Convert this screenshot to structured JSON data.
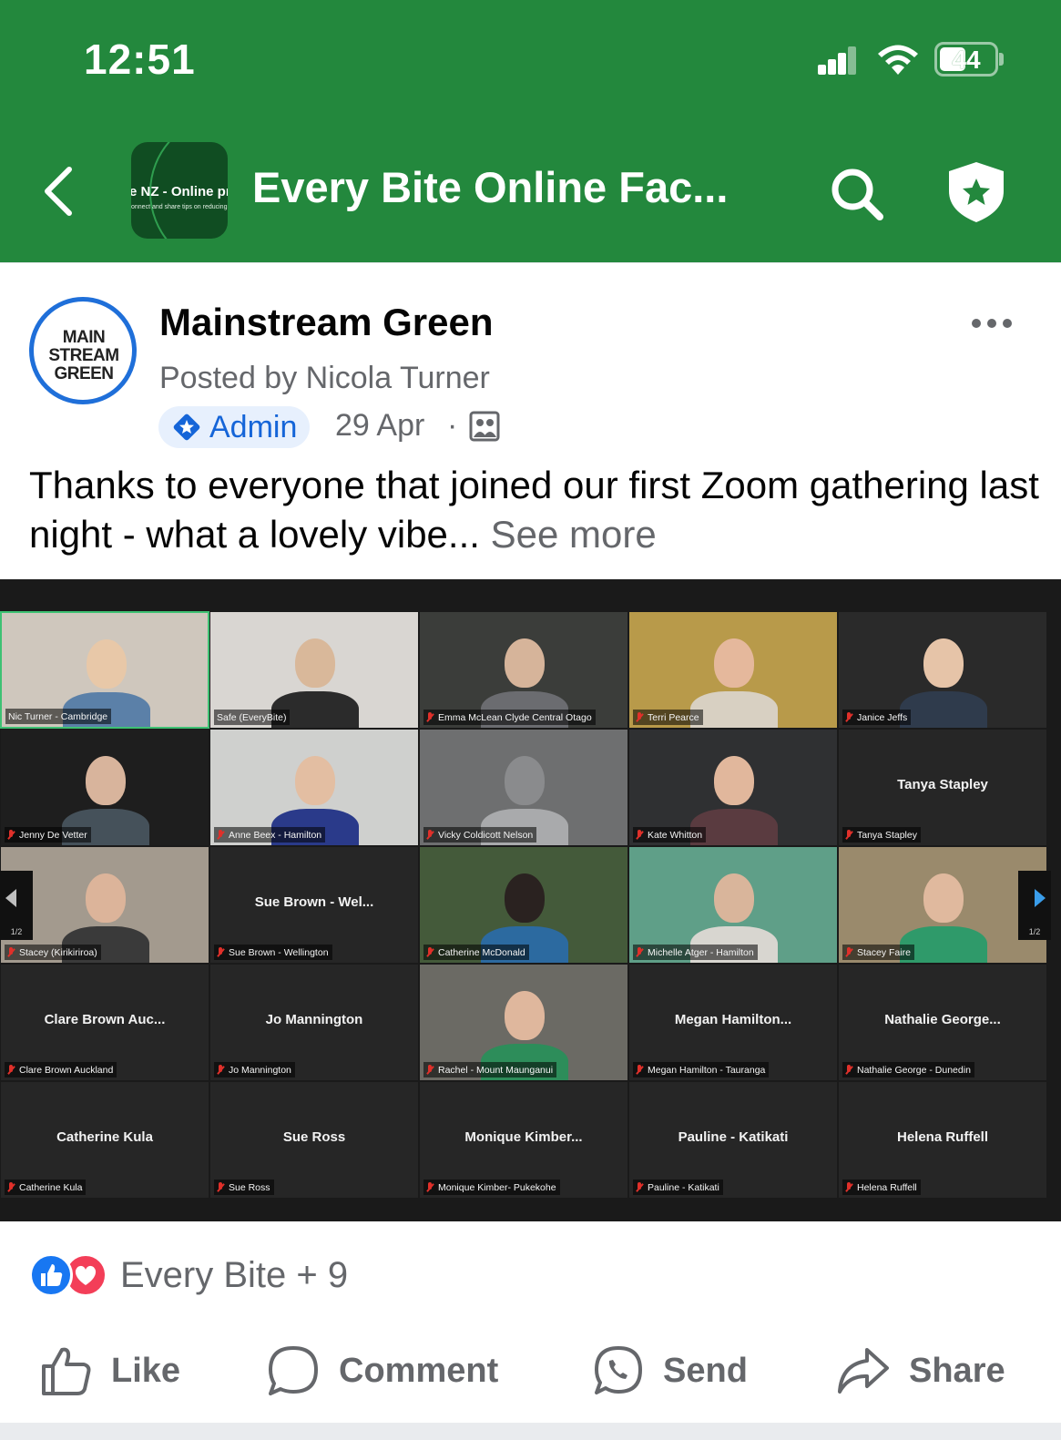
{
  "status_bar": {
    "time": "12:51",
    "battery": "44"
  },
  "header": {
    "group_title": "Every Bite Online Fac...",
    "thumb_line1": "e NZ - Online pr",
    "thumb_line2": "onnect and share tips on reducing",
    "icons": [
      "back-arrow-icon",
      "search-icon",
      "shield-star-icon"
    ]
  },
  "post": {
    "avatar_text": [
      "MAIN",
      "STREAM",
      "GREEN"
    ],
    "page_name": "Mainstream Green",
    "posted_by": "Posted by Nicola Turner",
    "badge": "Admin",
    "date": "29 Apr",
    "separator": "·",
    "text": "Thanks to everyone that joined our first Zoom gathering last night  -  what a lovely vibe...",
    "see_more": "See more"
  },
  "zoom": {
    "page_indicator": "1/2",
    "tiles": [
      {
        "label": "Nic Turner - Cambridge",
        "name": "",
        "video": true,
        "muted": false
      },
      {
        "label": "Safe (EveryBite)",
        "name": "",
        "video": true,
        "muted": false
      },
      {
        "label": "Emma McLean Clyde Central Otago",
        "name": "",
        "video": true,
        "muted": true
      },
      {
        "label": "Terri Pearce",
        "name": "",
        "video": true,
        "muted": true
      },
      {
        "label": "Janice Jeffs",
        "name": "",
        "video": true,
        "muted": true
      },
      {
        "label": "Jenny De Vetter",
        "name": "",
        "video": true,
        "muted": true
      },
      {
        "label": "Anne Beex - Hamilton",
        "name": "",
        "video": true,
        "muted": true
      },
      {
        "label": "Vicky Coldicott Nelson",
        "name": "",
        "video": true,
        "muted": true
      },
      {
        "label": "Kate Whitton",
        "name": "",
        "video": true,
        "muted": true
      },
      {
        "label": "Tanya Stapley",
        "name": "Tanya Stapley",
        "video": false,
        "muted": true
      },
      {
        "label": "Stacey (Kirikiriroa)",
        "name": "",
        "video": true,
        "muted": true
      },
      {
        "label": "Sue Brown - Wellington",
        "name": "Sue Brown - Wel...",
        "video": false,
        "muted": true
      },
      {
        "label": "Catherine McDonald",
        "name": "",
        "video": true,
        "muted": true
      },
      {
        "label": "Michelle Atger - Hamilton",
        "name": "",
        "video": true,
        "muted": true
      },
      {
        "label": "Stacey Faire",
        "name": "",
        "video": true,
        "muted": true
      },
      {
        "label": "Clare Brown Auckland",
        "name": "Clare Brown Auc...",
        "video": false,
        "muted": true
      },
      {
        "label": "Jo Mannington",
        "name": "Jo Mannington",
        "video": false,
        "muted": true
      },
      {
        "label": "Rachel - Mount Maunganui",
        "name": "",
        "video": true,
        "muted": true
      },
      {
        "label": "Megan Hamilton - Tauranga",
        "name": "Megan Hamilton...",
        "video": false,
        "muted": true
      },
      {
        "label": "Nathalie George - Dunedin",
        "name": "Nathalie George...",
        "video": false,
        "muted": true
      },
      {
        "label": "Catherine Kula",
        "name": "Catherine Kula",
        "video": false,
        "muted": true
      },
      {
        "label": "Sue Ross",
        "name": "Sue Ross",
        "video": false,
        "muted": true
      },
      {
        "label": "Monique Kimber- Pukekohe",
        "name": "Monique Kimber...",
        "video": false,
        "muted": true
      },
      {
        "label": "Pauline - Katikati",
        "name": "Pauline - Katikati",
        "video": false,
        "muted": true
      },
      {
        "label": "Helena Ruffell",
        "name": "Helena Ruffell",
        "video": false,
        "muted": true
      }
    ]
  },
  "reactions": {
    "summary": "Every Bite + 9",
    "types": [
      "like-icon",
      "love-icon"
    ]
  },
  "actions": {
    "like": "Like",
    "comment": "Comment",
    "send": "Send",
    "share": "Share"
  },
  "colors": {
    "header_green": "#23883d",
    "link_blue": "#1565d8",
    "muted_text": "#65676b"
  }
}
